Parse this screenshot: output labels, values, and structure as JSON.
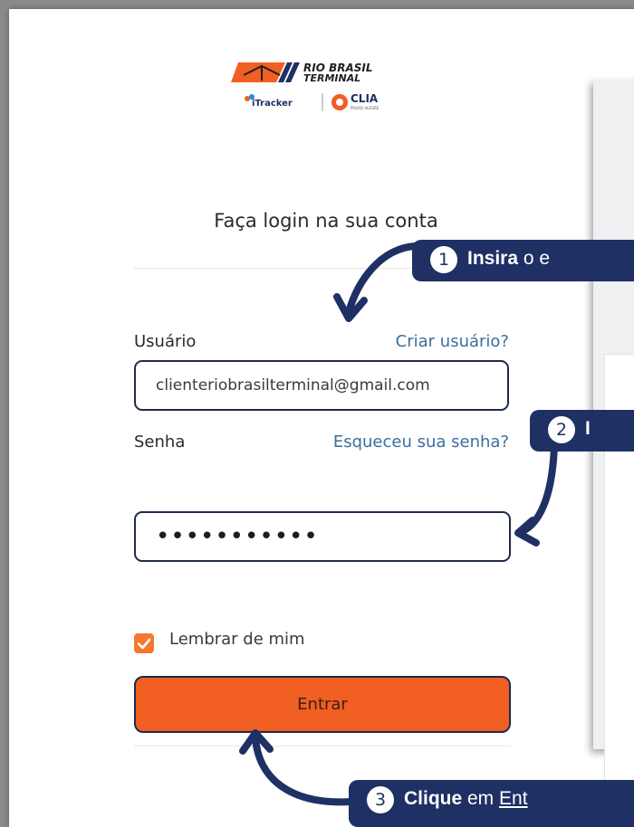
{
  "brand": {
    "logo_line1": "RIO BRASIL",
    "logo_line2": "TERMINAL",
    "itracker": "iTracker",
    "clia": "CLIA",
    "clia_sub": "POUSO ALEGRE",
    "orange": "#f15f22",
    "navy": "#1f3064"
  },
  "login": {
    "title": "Faça login na sua conta",
    "user_label": "Usuário",
    "create_user_link": "Criar usuário?",
    "user_value": "clienteriobrasilterminal@gmail.com",
    "password_label": "Senha",
    "forgot_link": "Esqueceu sua senha?",
    "password_value": "•••••••••••",
    "remember_label": "Lembrar de mim",
    "remember_checked": true,
    "submit_label": "Entrar"
  },
  "callouts": [
    {
      "number": "1",
      "bold": "Insira",
      "rest": " o e"
    },
    {
      "number": "2",
      "bold": "I",
      "rest": ""
    },
    {
      "number": "3",
      "bold": "Clique",
      "rest": " em ",
      "underline": "Ent"
    }
  ]
}
